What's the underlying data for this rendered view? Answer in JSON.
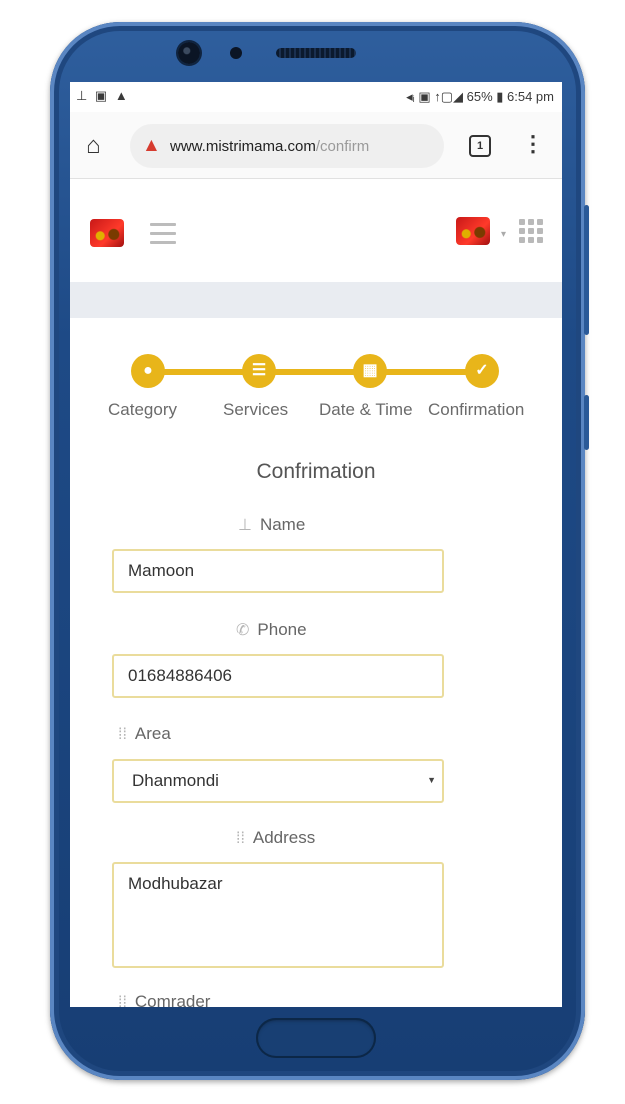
{
  "status_bar": {
    "left_icons": "⊥ ▣ ▲",
    "right_text": "◂ᵢ ▣ ↑▢◢ 65% ▮ 6:54 pm"
  },
  "browser": {
    "url_domain": "www.mistrimama.com",
    "url_path": "/confirm",
    "tab_count": "1"
  },
  "stepper": {
    "steps": [
      {
        "label": "Category",
        "icon": "map-pin-icon",
        "glyph": "●"
      },
      {
        "label": "Services",
        "icon": "list-icon",
        "glyph": "☰"
      },
      {
        "label": "Date & Time",
        "icon": "calendar-icon",
        "glyph": "▦"
      },
      {
        "label": "Confirmation",
        "icon": "check-icon",
        "glyph": "✓"
      }
    ],
    "accent_color": "#e8b51a"
  },
  "form": {
    "title": "Confrimation",
    "name_label": "Name",
    "name_value": "Mamoon",
    "phone_label": "Phone",
    "phone_value": "01684886406",
    "area_label": "Area",
    "area_value": "Dhanmondi",
    "address_label": "Address",
    "address_value": "Modhubazar",
    "next_label": "Comrader"
  }
}
